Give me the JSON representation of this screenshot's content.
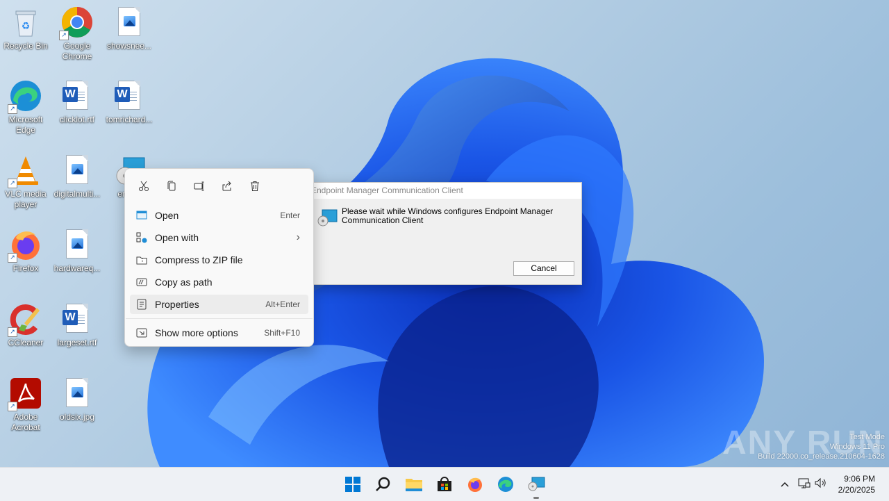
{
  "desktop": {
    "icons": [
      {
        "label": "Recycle Bin",
        "type": "recycle-bin"
      },
      {
        "label": "Google Chrome",
        "type": "chrome"
      },
      {
        "label": "showsnee...",
        "type": "image"
      },
      {
        "label": "Microsoft Edge",
        "type": "edge"
      },
      {
        "label": "clicklot.rtf",
        "type": "word"
      },
      {
        "label": "tomrichard...",
        "type": "word"
      },
      {
        "label": "VLC media player",
        "type": "vlc"
      },
      {
        "label": "digitalmulti...",
        "type": "image"
      },
      {
        "label": "em_...",
        "type": "installer"
      },
      {
        "label": "Firefox",
        "type": "firefox"
      },
      {
        "label": "hardwareq...",
        "type": "image"
      },
      {
        "label": "CCleaner",
        "type": "ccleaner"
      },
      {
        "label": "largeset.rtf",
        "type": "word"
      },
      {
        "label": "Adobe Acrobat",
        "type": "acrobat"
      },
      {
        "label": "oldsix.jpg",
        "type": "image"
      }
    ]
  },
  "context_menu": {
    "quick_actions": [
      "cut-icon",
      "copy-icon",
      "rename-icon",
      "share-icon",
      "delete-icon"
    ],
    "items": [
      {
        "label": "Open",
        "accel": "Enter",
        "icon": "open-icon"
      },
      {
        "label": "Open with",
        "accel": "",
        "icon": "open-with-icon",
        "submenu": true
      },
      {
        "label": "Compress to ZIP file",
        "accel": "",
        "icon": "zip-icon"
      },
      {
        "label": "Copy as path",
        "accel": "",
        "icon": "path-icon"
      },
      {
        "label": "Properties",
        "accel": "Alt+Enter",
        "icon": "properties-icon"
      },
      {
        "label": "Show more options",
        "accel": "Shift+F10",
        "icon": "more-options-icon"
      }
    ]
  },
  "dialog": {
    "title": "Endpoint Manager Communication Client",
    "message": "Please wait while Windows configures Endpoint Manager Communication Client",
    "cancel_label": "Cancel"
  },
  "taskbar": {
    "apps": [
      "start-icon",
      "search-icon",
      "file-explorer-icon",
      "store-icon",
      "firefox-icon",
      "edge-icon",
      "installer-icon"
    ],
    "tray": [
      "chevron-up-icon",
      "network-icon",
      "volume-icon"
    ],
    "time": "9:06 PM",
    "date": "2/20/2025"
  },
  "watermark": {
    "line1": "Test Mode",
    "line2": "Windows 11 Pro",
    "line3": "Build 22000.co_release.210604-1628",
    "brand": "ANY RUN"
  },
  "colors": {
    "accent": "#0067c0",
    "wallpaper_blue": "#1a4fd6",
    "menu_bg": "#f9f9f9"
  }
}
